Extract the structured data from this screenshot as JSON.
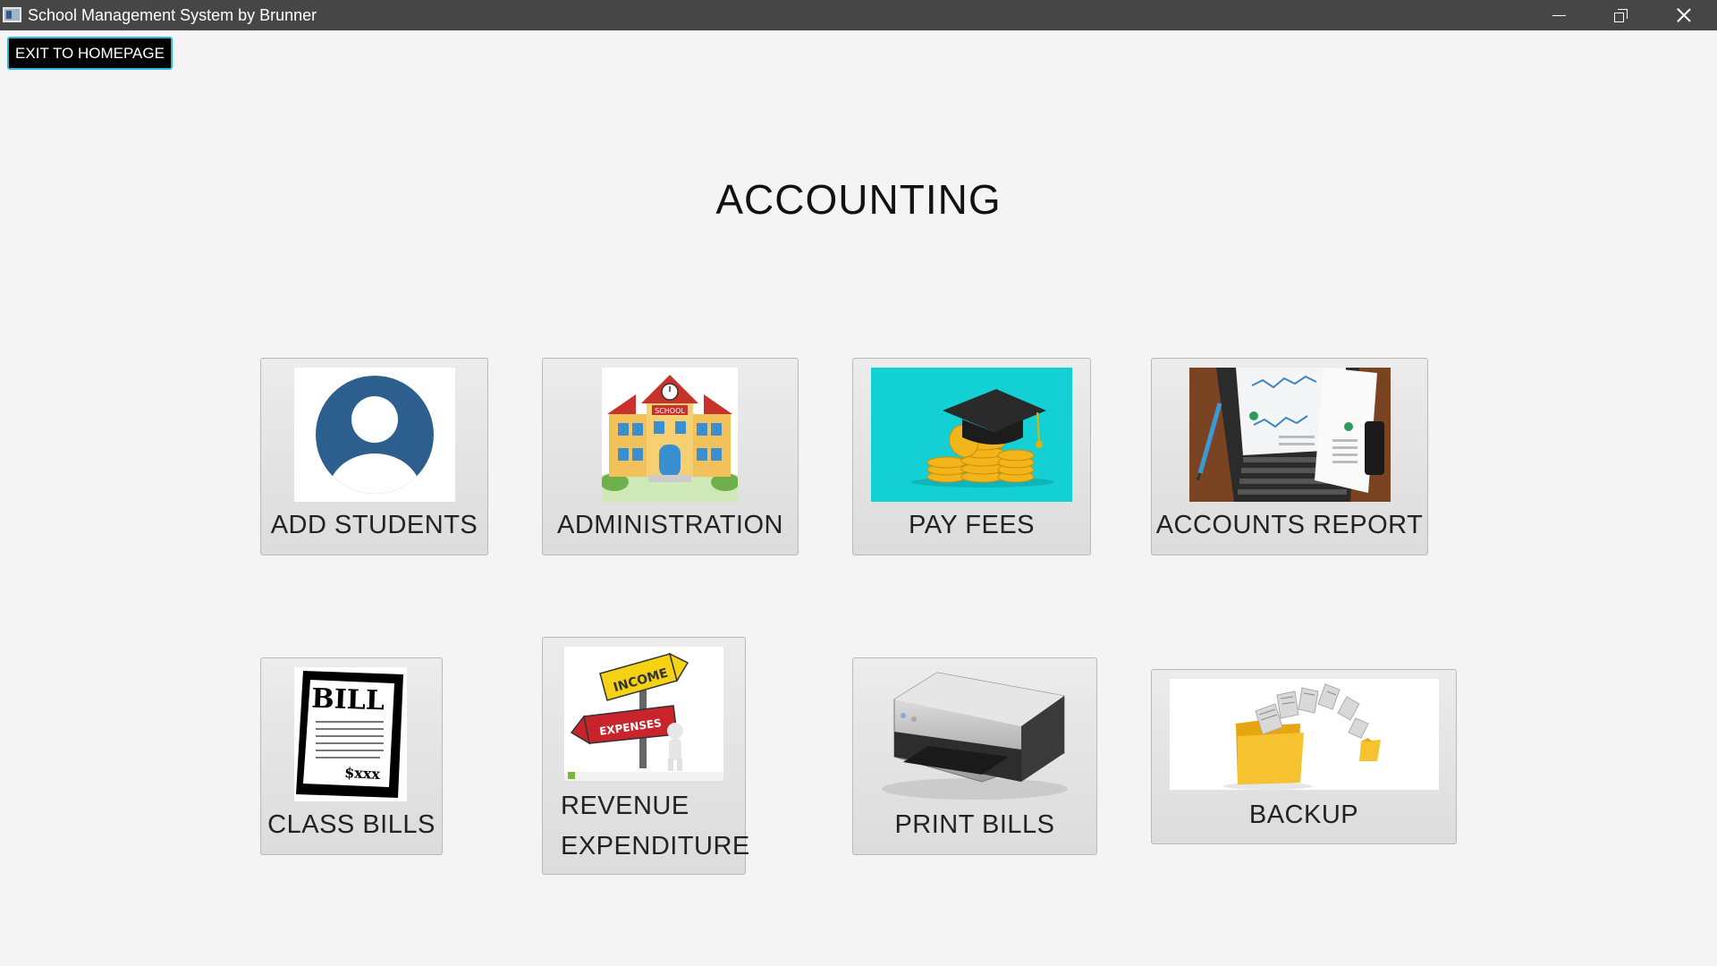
{
  "window": {
    "title": "School Management System by Brunner",
    "controls": [
      "minimize",
      "restore",
      "close"
    ]
  },
  "exit_button": {
    "label": "EXIT TO HOMEPAGE"
  },
  "heading": "ACCOUNTING",
  "tiles": [
    {
      "label": "ADD STUDENTS",
      "icon": "person-avatar-icon"
    },
    {
      "label": "ADMINISTRATION",
      "icon": "school-building-icon"
    },
    {
      "label": "PAY FEES",
      "icon": "graduation-cap-coins-icon"
    },
    {
      "label": "ACCOUNTS REPORT",
      "icon": "report-laptop-icon"
    },
    {
      "label": "CLASS BILLS",
      "icon": "bill-document-icon"
    },
    {
      "label": "REVENUE EXPENDITURE",
      "label_line1": "REVENUE",
      "label_line2": "EXPENDITURE",
      "icon": "income-expenses-sign-icon"
    },
    {
      "label": "PRINT BILLS",
      "icon": "printer-icon"
    },
    {
      "label": "BACKUP",
      "icon": "backup-folder-icon"
    }
  ],
  "image_text": {
    "administration_sign": "SCHOOL",
    "bill_heading": "BILL",
    "bill_amount": "$xxx",
    "income_sign": "INCOME",
    "expenses_sign": "EXPENSES"
  },
  "colors": {
    "titlebar": "#464646",
    "page_background": "#f4f4f4",
    "exit_button_bg": "#000000",
    "exit_button_border": "#2fb4d8",
    "avatar_blue": "#2c5f8d",
    "pay_fees_bg": "#12d0d3"
  }
}
